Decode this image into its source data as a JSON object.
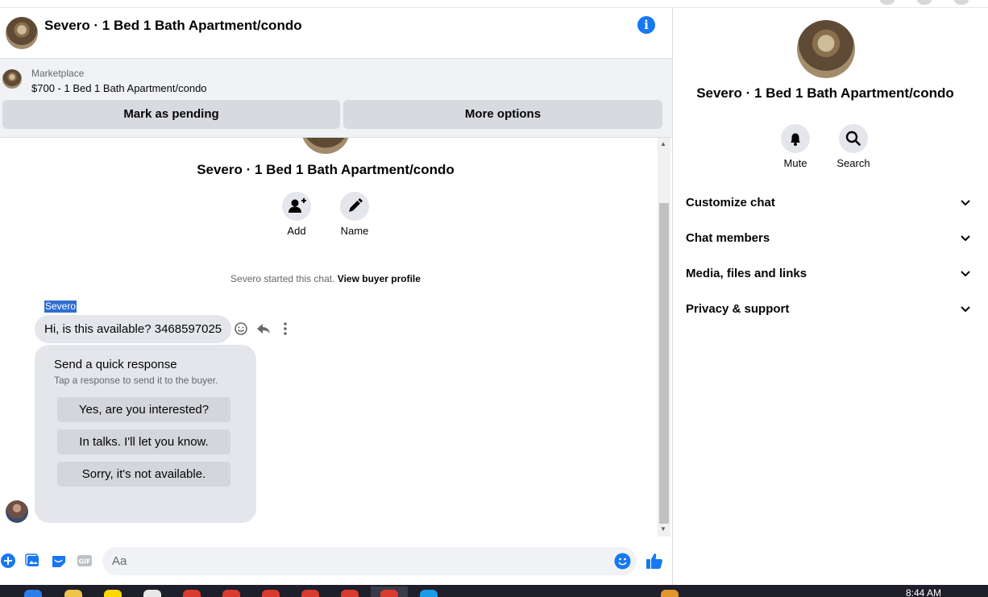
{
  "header": {
    "title": "Severo · 1 Bed 1 Bath Apartment/condo",
    "info_icon": "info-icon"
  },
  "marketplace": {
    "label": "Marketplace",
    "item": "$700 - 1 Bed 1 Bath Apartment/condo",
    "mark_pending_label": "Mark as pending",
    "more_options_label": "More options"
  },
  "conversation": {
    "title": "Severo · 1 Bed 1 Bath Apartment/condo",
    "actions": [
      {
        "label": "Add",
        "icon": "add-person-icon"
      },
      {
        "label": "Name",
        "icon": "pencil-icon"
      }
    ],
    "started_text": "Severo started this chat.",
    "view_profile_link": "View buyer profile",
    "sender_name": "Severo",
    "message_text": "Hi, is this available? 3468597025",
    "quick_response": {
      "title": "Send a quick response",
      "subtitle": "Tap a response to send it to the buyer.",
      "options": [
        "Yes, are you interested?",
        "In talks. I'll let you know.",
        "Sorry, it's not available."
      ]
    }
  },
  "composer": {
    "placeholder": "Aa"
  },
  "right_pane": {
    "title": "Severo · 1 Bed 1 Bath Apartment/condo",
    "mute_label": "Mute",
    "search_label": "Search",
    "sections": [
      "Customize chat",
      "Chat members",
      "Media, files and links",
      "Privacy & support"
    ]
  },
  "taskbar": {
    "time": "8:44 AM"
  },
  "colors": {
    "accent": "#1877f2",
    "surface": "#e4e6eb",
    "banner": "#f0f2f5"
  }
}
